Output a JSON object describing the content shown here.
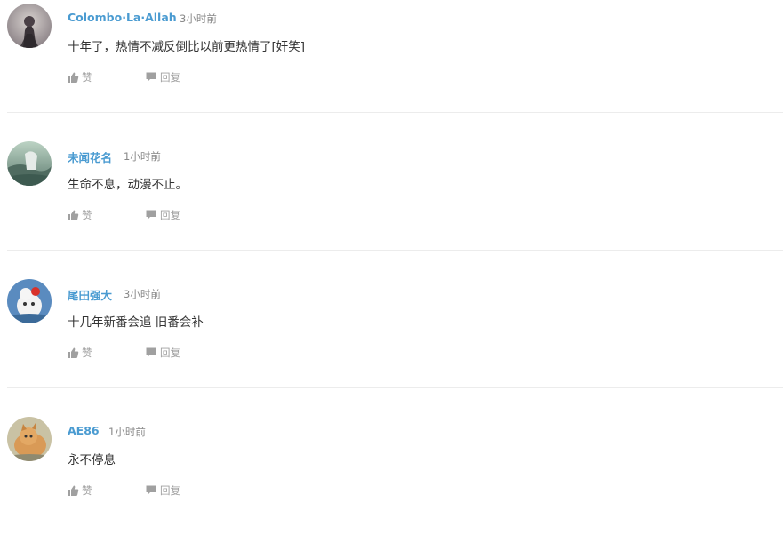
{
  "comments": [
    {
      "username": "Colombo·La·Allah",
      "time": "3小时前",
      "text": "十年了，热情不减反倒比以前更热情了[奸笑]",
      "like_label": "赞",
      "reply_label": "回复"
    },
    {
      "username": "未闻花名",
      "time": "1小时前",
      "text": "生命不息，动漫不止。",
      "like_label": "赞",
      "reply_label": "回复"
    },
    {
      "username": "尾田强大",
      "time": "3小时前",
      "text": "十几年新番会追 旧番会补",
      "like_label": "赞",
      "reply_label": "回复"
    },
    {
      "username": "AE86",
      "time": "1小时前",
      "text": "永不停息",
      "like_label": "赞",
      "reply_label": "回复"
    }
  ],
  "colors": {
    "username": "#4a9bd1",
    "text": "#333333",
    "meta": "#888888",
    "action": "#a0a0a0",
    "divider": "#ececec"
  },
  "icons": {
    "like": "thumbs-up-icon",
    "reply": "speech-bubble-icon"
  }
}
